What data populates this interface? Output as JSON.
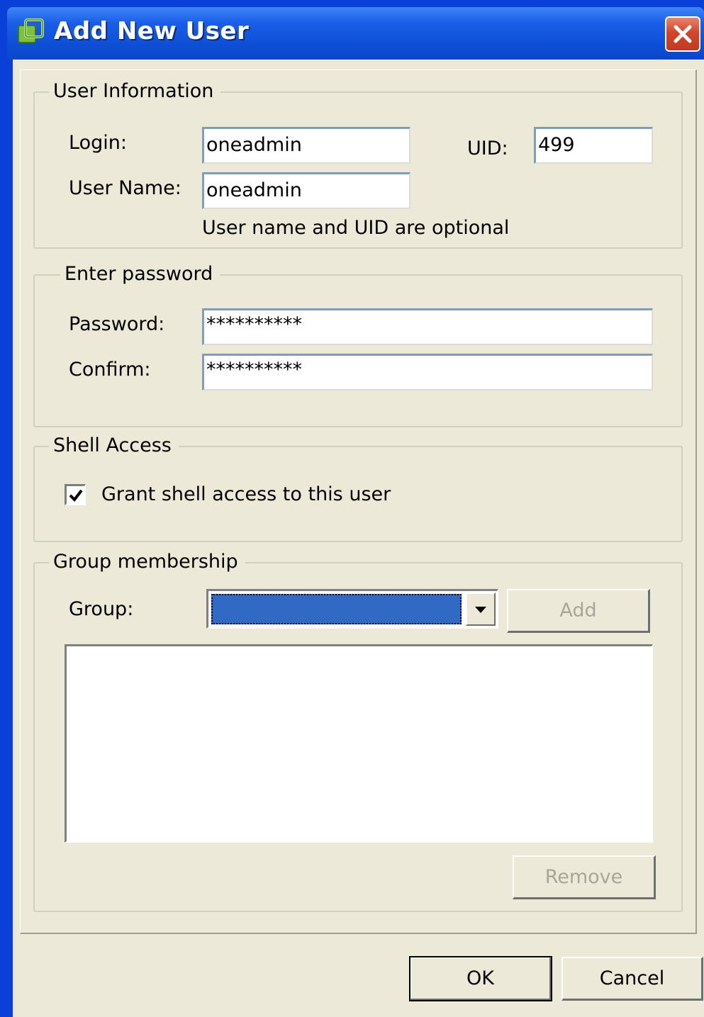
{
  "window": {
    "title": "Add New User"
  },
  "user_info": {
    "legend": "User Information",
    "login_label": "Login:",
    "login_value": "oneadmin",
    "uid_label": "UID:",
    "uid_value": "499",
    "username_label": "User Name:",
    "username_value": "oneadmin",
    "hint": "User name and UID are optional"
  },
  "password": {
    "legend": "Enter password",
    "password_label": "Password:",
    "password_value": "**********",
    "confirm_label": "Confirm:",
    "confirm_value": "**********"
  },
  "shell": {
    "legend": "Shell Access",
    "checkbox_label": "Grant shell access to this user",
    "checked": true
  },
  "groups": {
    "legend": "Group membership",
    "group_label": "Group:",
    "group_selected": "",
    "add_label": "Add",
    "remove_label": "Remove",
    "members": []
  },
  "buttons": {
    "ok_label": "OK",
    "cancel_label": "Cancel"
  },
  "colors": {
    "titlebar": "#0b47c9",
    "dialog_bg": "#ece9d8",
    "selection": "#316ac5",
    "close": "#d2452a"
  }
}
